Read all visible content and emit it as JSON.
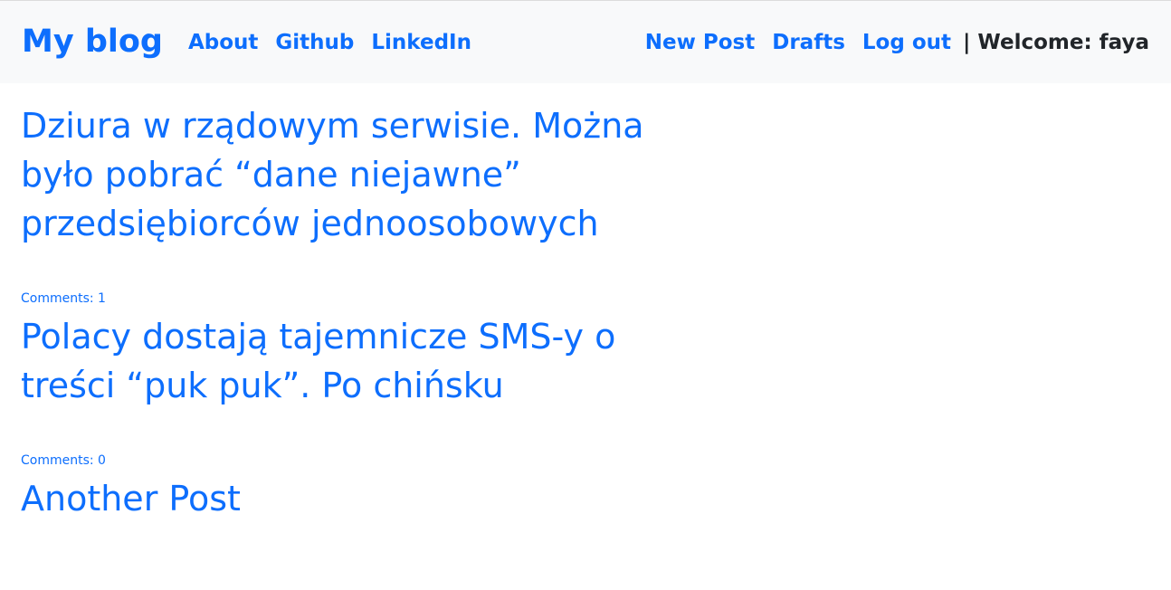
{
  "nav": {
    "brand": "My blog",
    "left_links": [
      "About",
      "Github",
      "LinkedIn"
    ],
    "right_links": [
      "New Post",
      "Drafts",
      "Log out"
    ],
    "welcome": "| Welcome: faya"
  },
  "posts": [
    {
      "title": "Dziura w rządowym serwisie. Można było pobrać “dane niejawne” przedsiębiorców jednoosobowych",
      "comments": "Comments: 1"
    },
    {
      "title": "Polacy dostają tajemnicze SMS-y o treści “puk puk”. Po chińsku",
      "comments": "Comments: 0"
    },
    {
      "title": "Another Post"
    }
  ],
  "colors": {
    "link": "#0d6efd",
    "navbar_bg": "#f8f9fa",
    "text_dark": "#212529"
  }
}
